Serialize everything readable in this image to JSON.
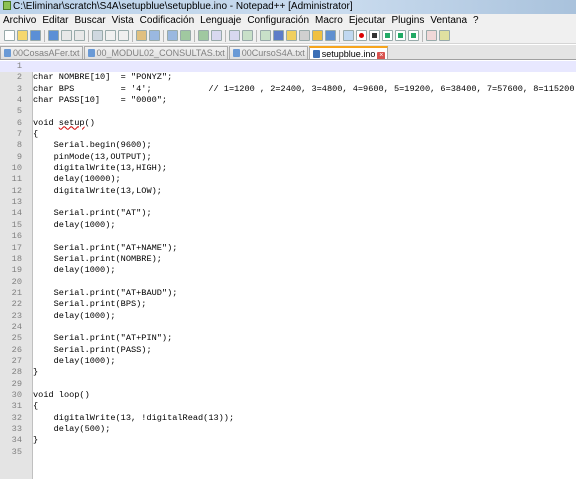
{
  "window": {
    "title": "C:\\Eliminar\\scratch\\S4A\\setupblue\\setupblue.ino - Notepad++ [Administrator]"
  },
  "menu": [
    "Archivo",
    "Editar",
    "Buscar",
    "Vista",
    "Codificación",
    "Lenguaje",
    "Configuración",
    "Macro",
    "Ejecutar",
    "Plugins",
    "Ventana",
    "?"
  ],
  "toolbar": {
    "icons": [
      "new-file-icon",
      "open-file-icon",
      "save-icon",
      "save-all-icon",
      "close-icon",
      "close-all-icon",
      "print-icon",
      "cut-icon",
      "copy-icon",
      "paste-icon",
      "undo-icon",
      "redo-icon",
      "find-icon",
      "replace-icon",
      "zoom-in-icon",
      "zoom-out-icon",
      "sync-v-icon",
      "sync-h-icon",
      "word-wrap-icon",
      "all-chars-icon",
      "indent-guide-icon",
      "udl-icon",
      "doc-map-icon",
      "function-list-icon",
      "record-macro-icon",
      "stop-record-icon",
      "play-macro-icon",
      "run-macro-multiple-icon",
      "save-macro-icon",
      "spell-check-icon",
      "misc-icon"
    ]
  },
  "tabs": [
    {
      "label": "00CosasAFer.txt",
      "active": false
    },
    {
      "label": "00_MODUL02_CONSULTAS.txt",
      "active": false
    },
    {
      "label": "00CursoS4A.txt",
      "active": false
    },
    {
      "label": "setupblue.ino",
      "active": true
    }
  ],
  "editor": {
    "lines": [
      {
        "n": "1",
        "text": ""
      },
      {
        "n": "2",
        "text": "char NOMBRE[10]  = \"PONYZ\";"
      },
      {
        "n": "3",
        "text": "char BPS         = '4';           // 1=1200 , 2=2400, 3=4800, 4=9600, 5=19200, 6=38400, 7=57600, 8=115200"
      },
      {
        "n": "4",
        "text": "char PASS[10]    = \"0000\";"
      },
      {
        "n": "5",
        "text": ""
      },
      {
        "n": "6",
        "text": "void setup()"
      },
      {
        "n": "7",
        "text": "{"
      },
      {
        "n": "8",
        "text": "    Serial.begin(9600);"
      },
      {
        "n": "9",
        "text": "    pinMode(13,OUTPUT);"
      },
      {
        "n": "10",
        "text": "    digitalWrite(13,HIGH);"
      },
      {
        "n": "11",
        "text": "    delay(10000);"
      },
      {
        "n": "12",
        "text": "    digitalWrite(13,LOW);"
      },
      {
        "n": "13",
        "text": ""
      },
      {
        "n": "14",
        "text": "    Serial.print(\"AT\");"
      },
      {
        "n": "15",
        "text": "    delay(1000);"
      },
      {
        "n": "16",
        "text": ""
      },
      {
        "n": "17",
        "text": "    Serial.print(\"AT+NAME\");"
      },
      {
        "n": "18",
        "text": "    Serial.print(NOMBRE);"
      },
      {
        "n": "19",
        "text": "    delay(1000);"
      },
      {
        "n": "20",
        "text": ""
      },
      {
        "n": "21",
        "text": "    Serial.print(\"AT+BAUD\");"
      },
      {
        "n": "22",
        "text": "    Serial.print(BPS);"
      },
      {
        "n": "23",
        "text": "    delay(1000);"
      },
      {
        "n": "24",
        "text": ""
      },
      {
        "n": "25",
        "text": "    Serial.print(\"AT+PIN\");"
      },
      {
        "n": "26",
        "text": "    Serial.print(PASS);"
      },
      {
        "n": "27",
        "text": "    delay(1000);"
      },
      {
        "n": "28",
        "text": "}"
      },
      {
        "n": "29",
        "text": ""
      },
      {
        "n": "30",
        "text": "void loop()"
      },
      {
        "n": "31",
        "text": "{"
      },
      {
        "n": "32",
        "text": "    digitalWrite(13, !digitalRead(13));"
      },
      {
        "n": "33",
        "text": "    delay(500);"
      },
      {
        "n": "34",
        "text": "}"
      },
      {
        "n": "35",
        "text": ""
      }
    ]
  },
  "colors": {
    "gutter": "#e4e4e4",
    "active_tab_accent": "#f7a51c",
    "current_line": "#e8e8ff"
  }
}
